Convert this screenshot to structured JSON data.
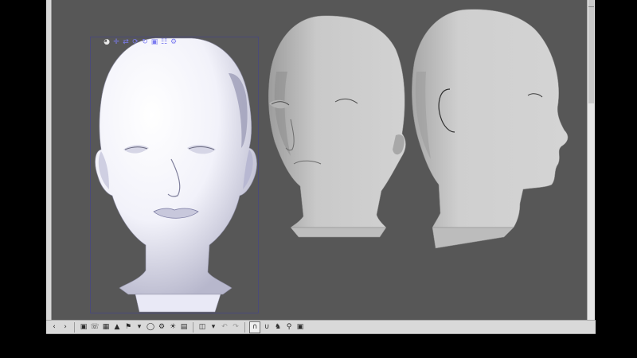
{
  "app": {
    "accent_color": "#7c7cf0",
    "canvas_color": "#575757",
    "chrome_color": "#d9d9d9"
  },
  "manipulator_toolbar": {
    "icons": [
      "camera-rotate-icon",
      "move-icon",
      "pan-icon",
      "rotate-x-icon",
      "rotate-y-icon",
      "scale-icon",
      "object-list-icon",
      "gear-icon"
    ]
  },
  "bottom_toolbar": {
    "icons": [
      "chevron-left-icon",
      "chevron-right-icon",
      "camera-icon",
      "reset-camera-icon",
      "fit-view-icon",
      "floor-icon",
      "edit-pose-icon",
      "layout-icon",
      "rotate-icon",
      "settings-icon",
      "light-icon",
      "frame-icon",
      "view-icon",
      "undo-icon",
      "redo-icon",
      "magnet-icon",
      "pose-icon",
      "animal-icon",
      "pin-icon",
      "lock-icon"
    ]
  },
  "models": [
    {
      "view": "front",
      "selected": true
    },
    {
      "view": "three-quarter",
      "selected": false
    },
    {
      "view": "profile",
      "selected": false
    }
  ]
}
